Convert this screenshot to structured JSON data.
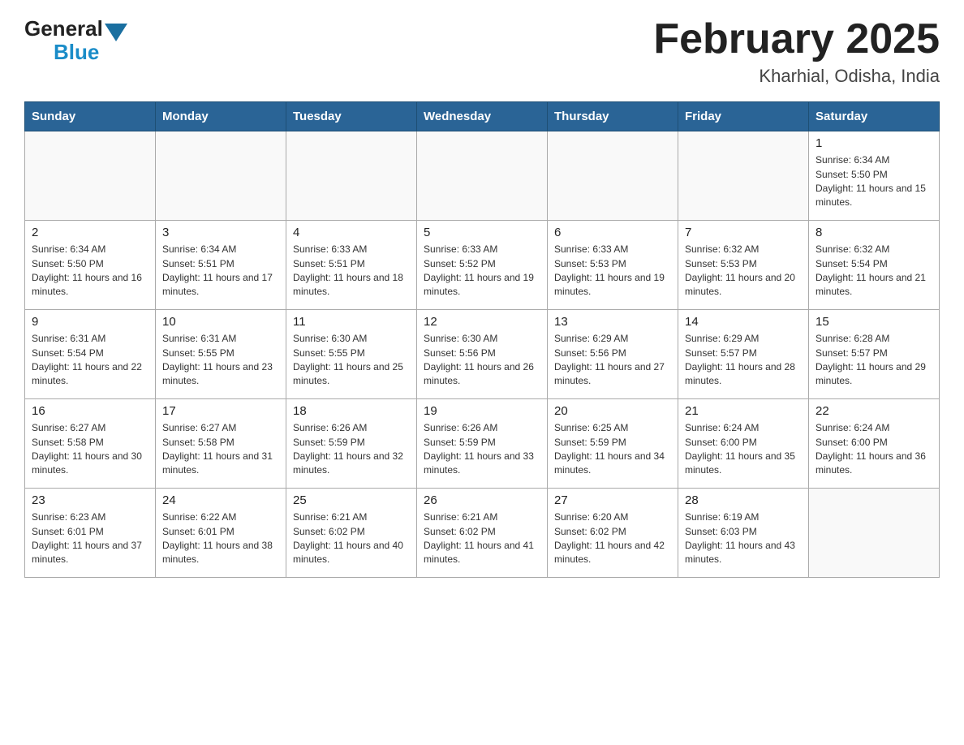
{
  "header": {
    "logo_general": "General",
    "logo_blue": "Blue",
    "month_title": "February 2025",
    "location": "Kharhial, Odisha, India"
  },
  "days_of_week": [
    "Sunday",
    "Monday",
    "Tuesday",
    "Wednesday",
    "Thursday",
    "Friday",
    "Saturday"
  ],
  "weeks": [
    {
      "days": [
        {
          "date": "",
          "info": ""
        },
        {
          "date": "",
          "info": ""
        },
        {
          "date": "",
          "info": ""
        },
        {
          "date": "",
          "info": ""
        },
        {
          "date": "",
          "info": ""
        },
        {
          "date": "",
          "info": ""
        },
        {
          "date": "1",
          "info": "Sunrise: 6:34 AM\nSunset: 5:50 PM\nDaylight: 11 hours and 15 minutes."
        }
      ]
    },
    {
      "days": [
        {
          "date": "2",
          "info": "Sunrise: 6:34 AM\nSunset: 5:50 PM\nDaylight: 11 hours and 16 minutes."
        },
        {
          "date": "3",
          "info": "Sunrise: 6:34 AM\nSunset: 5:51 PM\nDaylight: 11 hours and 17 minutes."
        },
        {
          "date": "4",
          "info": "Sunrise: 6:33 AM\nSunset: 5:51 PM\nDaylight: 11 hours and 18 minutes."
        },
        {
          "date": "5",
          "info": "Sunrise: 6:33 AM\nSunset: 5:52 PM\nDaylight: 11 hours and 19 minutes."
        },
        {
          "date": "6",
          "info": "Sunrise: 6:33 AM\nSunset: 5:53 PM\nDaylight: 11 hours and 19 minutes."
        },
        {
          "date": "7",
          "info": "Sunrise: 6:32 AM\nSunset: 5:53 PM\nDaylight: 11 hours and 20 minutes."
        },
        {
          "date": "8",
          "info": "Sunrise: 6:32 AM\nSunset: 5:54 PM\nDaylight: 11 hours and 21 minutes."
        }
      ]
    },
    {
      "days": [
        {
          "date": "9",
          "info": "Sunrise: 6:31 AM\nSunset: 5:54 PM\nDaylight: 11 hours and 22 minutes."
        },
        {
          "date": "10",
          "info": "Sunrise: 6:31 AM\nSunset: 5:55 PM\nDaylight: 11 hours and 23 minutes."
        },
        {
          "date": "11",
          "info": "Sunrise: 6:30 AM\nSunset: 5:55 PM\nDaylight: 11 hours and 25 minutes."
        },
        {
          "date": "12",
          "info": "Sunrise: 6:30 AM\nSunset: 5:56 PM\nDaylight: 11 hours and 26 minutes."
        },
        {
          "date": "13",
          "info": "Sunrise: 6:29 AM\nSunset: 5:56 PM\nDaylight: 11 hours and 27 minutes."
        },
        {
          "date": "14",
          "info": "Sunrise: 6:29 AM\nSunset: 5:57 PM\nDaylight: 11 hours and 28 minutes."
        },
        {
          "date": "15",
          "info": "Sunrise: 6:28 AM\nSunset: 5:57 PM\nDaylight: 11 hours and 29 minutes."
        }
      ]
    },
    {
      "days": [
        {
          "date": "16",
          "info": "Sunrise: 6:27 AM\nSunset: 5:58 PM\nDaylight: 11 hours and 30 minutes."
        },
        {
          "date": "17",
          "info": "Sunrise: 6:27 AM\nSunset: 5:58 PM\nDaylight: 11 hours and 31 minutes."
        },
        {
          "date": "18",
          "info": "Sunrise: 6:26 AM\nSunset: 5:59 PM\nDaylight: 11 hours and 32 minutes."
        },
        {
          "date": "19",
          "info": "Sunrise: 6:26 AM\nSunset: 5:59 PM\nDaylight: 11 hours and 33 minutes."
        },
        {
          "date": "20",
          "info": "Sunrise: 6:25 AM\nSunset: 5:59 PM\nDaylight: 11 hours and 34 minutes."
        },
        {
          "date": "21",
          "info": "Sunrise: 6:24 AM\nSunset: 6:00 PM\nDaylight: 11 hours and 35 minutes."
        },
        {
          "date": "22",
          "info": "Sunrise: 6:24 AM\nSunset: 6:00 PM\nDaylight: 11 hours and 36 minutes."
        }
      ]
    },
    {
      "days": [
        {
          "date": "23",
          "info": "Sunrise: 6:23 AM\nSunset: 6:01 PM\nDaylight: 11 hours and 37 minutes."
        },
        {
          "date": "24",
          "info": "Sunrise: 6:22 AM\nSunset: 6:01 PM\nDaylight: 11 hours and 38 minutes."
        },
        {
          "date": "25",
          "info": "Sunrise: 6:21 AM\nSunset: 6:02 PM\nDaylight: 11 hours and 40 minutes."
        },
        {
          "date": "26",
          "info": "Sunrise: 6:21 AM\nSunset: 6:02 PM\nDaylight: 11 hours and 41 minutes."
        },
        {
          "date": "27",
          "info": "Sunrise: 6:20 AM\nSunset: 6:02 PM\nDaylight: 11 hours and 42 minutes."
        },
        {
          "date": "28",
          "info": "Sunrise: 6:19 AM\nSunset: 6:03 PM\nDaylight: 11 hours and 43 minutes."
        },
        {
          "date": "",
          "info": ""
        }
      ]
    }
  ]
}
